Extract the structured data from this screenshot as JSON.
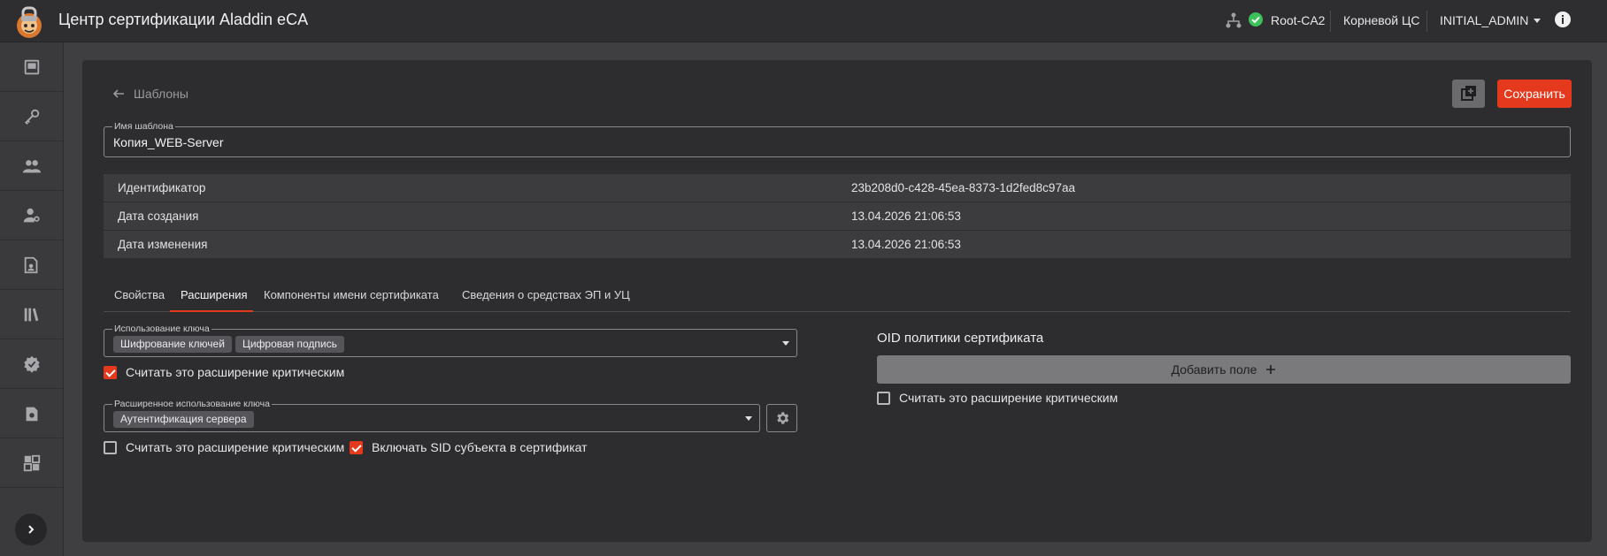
{
  "header": {
    "title": "Центр сертификации Aladdin eCA",
    "ca_name": "Root-CA2",
    "ca_type": "Корневой ЦС",
    "user": "INITIAL_ADMIN"
  },
  "sidebar": {
    "items": [
      {
        "icon": "dashboard-icon"
      },
      {
        "icon": "key-icon"
      },
      {
        "icon": "users-icon"
      },
      {
        "icon": "user-key-icon"
      },
      {
        "icon": "certificate-request-icon"
      },
      {
        "icon": "library-icon"
      },
      {
        "icon": "certificate-check-icon"
      },
      {
        "icon": "template-icon"
      },
      {
        "icon": "settings-grid-icon"
      }
    ]
  },
  "page": {
    "back_label": "Шаблоны",
    "save_label": "Сохранить",
    "template_name": {
      "label": "Имя шаблона",
      "value": "Копия_WEB-Server"
    },
    "info": [
      {
        "key": "Идентификатор",
        "value": "23b208d0-c428-45ea-8373-1d2fed8c97aa"
      },
      {
        "key": "Дата создания",
        "value": "13.04.2026 21:06:53"
      },
      {
        "key": "Дата изменения",
        "value": "13.04.2026 21:06:53"
      }
    ],
    "tabs": [
      "Свойства",
      "Расширения",
      "Компоненты имени сертификата",
      "Сведения о средствах ЭП и УЦ"
    ],
    "active_tab": "Расширения"
  },
  "extensions": {
    "key_usage": {
      "label": "Использование ключа",
      "chips": [
        "Шифрование ключей",
        "Цифровая подпись"
      ],
      "critical_label": "Считать это расширение критическим",
      "critical": true
    },
    "ext_key_usage": {
      "label": "Расширенное использование ключа",
      "chips": [
        "Аутентификация сервера"
      ],
      "critical_label": "Считать это расширение критическим",
      "critical": false,
      "sid_label": "Включать SID субъекта в сертификат",
      "sid": true
    },
    "oid_policy": {
      "title": "OID политики сертификата",
      "add_label": "Добавить поле",
      "critical_label": "Считать это расширение критическим",
      "critical": false
    }
  },
  "colors": {
    "accent": "#e5391d",
    "ok": "#3cc05a"
  }
}
